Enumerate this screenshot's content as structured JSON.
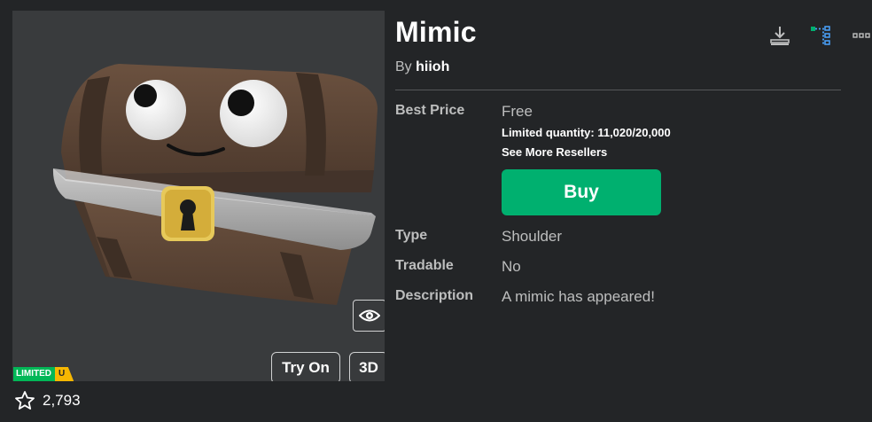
{
  "item": {
    "name": "Mimic",
    "by_prefix": "By",
    "creator": "hiioh"
  },
  "pricing": {
    "best_price_label": "Best Price",
    "best_price_value": "Free",
    "limited_quantity": "Limited quantity: 11,020/20,000",
    "resellers_link": "See More Resellers",
    "buy_label": "Buy"
  },
  "details": {
    "type_label": "Type",
    "type_value": "Shoulder",
    "tradable_label": "Tradable",
    "tradable_value": "No",
    "description_label": "Description",
    "description_value": "A mimic has appeared!"
  },
  "thumbnail": {
    "try_on_label": "Try On",
    "three_d_label": "3D",
    "badge_limited": "LIMITED",
    "badge_u": "U"
  },
  "favorites": {
    "count": "2,793"
  },
  "colors": {
    "background": "#232527",
    "thumbnail_bg": "#393b3d",
    "buy_green": "#00b06f",
    "limited_green": "#02b757",
    "unique_yellow": "#f6b702"
  },
  "icons": {
    "download": "download-icon",
    "hierarchy": "hierarchy-icon",
    "more": "more-icon",
    "eye": "eye-icon",
    "star": "star-icon"
  }
}
